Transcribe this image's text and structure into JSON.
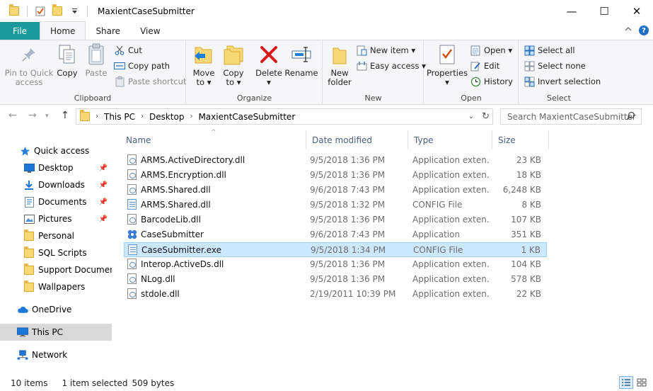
{
  "window": {
    "title": "MaxientCaseSubmitter",
    "minimize_glyph": "—",
    "maximize_glyph": "☐",
    "close_glyph": "✕"
  },
  "ribbon_tabs": [
    {
      "label": "File"
    },
    {
      "label": "Home"
    },
    {
      "label": "Share"
    },
    {
      "label": "View"
    }
  ],
  "clipboard": {
    "pin_label_1": "Pin to Quick",
    "pin_label_2": "access",
    "copy": "Copy",
    "paste": "Paste",
    "cut": "Cut",
    "copy_path": "Copy path",
    "paste_shortcut": "Paste shortcut",
    "group": "Clipboard"
  },
  "organize": {
    "move_to_1": "Move",
    "move_to_2": "to ▾",
    "copy_to_1": "Copy",
    "copy_to_2": "to ▾",
    "delete_1": "Delete",
    "delete_2": "▾",
    "rename": "Rename",
    "group": "Organize"
  },
  "new_group": {
    "new_folder_1": "New",
    "new_folder_2": "folder",
    "new_item": "New item ▾",
    "easy_access": "Easy access ▾",
    "group": "New"
  },
  "open_group": {
    "properties_1": "Properties",
    "properties_2": "▾",
    "open": "Open ▾",
    "edit": "Edit",
    "history": "History",
    "group": "Open"
  },
  "select_group": {
    "select_all": "Select all",
    "select_none": "Select none",
    "invert": "Invert selection",
    "group": "Select"
  },
  "address": {
    "crumbs": [
      "This PC",
      "Desktop",
      "MaxientCaseSubmitter"
    ],
    "search_placeholder": "Search MaxientCaseSubmitter"
  },
  "nav": {
    "quick_access": "Quick access",
    "items": [
      {
        "label": "Desktop",
        "icon": "desktop-icon",
        "pinned": true
      },
      {
        "label": "Downloads",
        "icon": "download-icon",
        "pinned": true
      },
      {
        "label": "Documents",
        "icon": "documents-icon",
        "pinned": true
      },
      {
        "label": "Pictures",
        "icon": "pictures-icon",
        "pinned": true
      },
      {
        "label": "Personal",
        "icon": "folder-icon",
        "pinned": false
      },
      {
        "label": "SQL Scripts",
        "icon": "folder-icon",
        "pinned": false
      },
      {
        "label": "Support Documents",
        "icon": "folder-icon",
        "pinned": false
      },
      {
        "label": "Wallpapers",
        "icon": "folder-icon",
        "pinned": false
      }
    ],
    "onedrive": "OneDrive",
    "this_pc": "This PC",
    "network": "Network"
  },
  "columns": {
    "name": "Name",
    "date": "Date modified",
    "type": "Type",
    "size": "Size"
  },
  "files": [
    {
      "name": "ARMS.ActiveDirectory.dll",
      "date": "9/5/2018 1:36 PM",
      "type": "Application exten...",
      "size": "23 KB",
      "icon": "dll"
    },
    {
      "name": "ARMS.Encryption.dll",
      "date": "9/5/2018 1:36 PM",
      "type": "Application exten...",
      "size": "18 KB",
      "icon": "dll"
    },
    {
      "name": "ARMS.Shared.dll",
      "date": "9/6/2018 7:43 PM",
      "type": "Application exten...",
      "size": "6,248 KB",
      "icon": "dll"
    },
    {
      "name": "ARMS.Shared.dll",
      "date": "9/5/2018 1:32 PM",
      "type": "CONFIG File",
      "size": "8 KB",
      "icon": "config"
    },
    {
      "name": "BarcodeLib.dll",
      "date": "9/5/2018 1:36 PM",
      "type": "Application exten...",
      "size": "107 KB",
      "icon": "dll"
    },
    {
      "name": "CaseSubmitter",
      "date": "9/6/2018 7:43 PM",
      "type": "Application",
      "size": "351 KB",
      "icon": "app"
    },
    {
      "name": "CaseSubmitter.exe",
      "date": "9/5/2018 1:34 PM",
      "type": "CONFIG File",
      "size": "1 KB",
      "icon": "config",
      "selected": true
    },
    {
      "name": "Interop.ActiveDs.dll",
      "date": "9/5/2018 1:36 PM",
      "type": "Application exten...",
      "size": "104 KB",
      "icon": "dll"
    },
    {
      "name": "NLog.dll",
      "date": "9/5/2018 1:36 PM",
      "type": "Application exten...",
      "size": "578 KB",
      "icon": "dll"
    },
    {
      "name": "stdole.dll",
      "date": "2/19/2011 10:39 PM",
      "type": "Application exten...",
      "size": "22 KB",
      "icon": "dll"
    }
  ],
  "status": {
    "items": "10 items",
    "selected": "1 item selected",
    "bytes": "509 bytes"
  }
}
